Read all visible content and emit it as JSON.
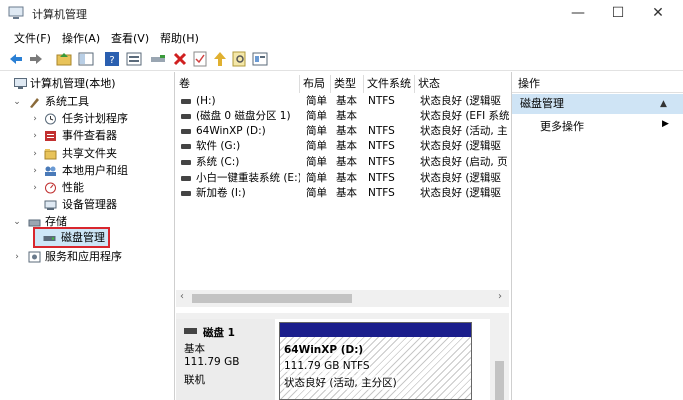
{
  "window": {
    "title": "计算机管理",
    "buttons": {
      "minimize": "—",
      "maximize": "☐",
      "close": "✕"
    }
  },
  "menu": [
    "文件(F)",
    "操作(A)",
    "查看(V)",
    "帮助(H)"
  ],
  "tree": {
    "root": "计算机管理(本地)",
    "items": [
      {
        "label": "系统工具",
        "icon": "tools-icon"
      },
      {
        "label": "任务计划程序",
        "icon": "clock-icon"
      },
      {
        "label": "事件查看器",
        "icon": "event-icon"
      },
      {
        "label": "共享文件夹",
        "icon": "folder-icon"
      },
      {
        "label": "本地用户和组",
        "icon": "users-icon"
      },
      {
        "label": "性能",
        "icon": "performance-icon"
      },
      {
        "label": "设备管理器",
        "icon": "device-icon"
      },
      {
        "label": "存储",
        "icon": "storage-icon"
      },
      {
        "label": "磁盘管理",
        "icon": "disk-icon"
      },
      {
        "label": "服务和应用程序",
        "icon": "services-icon"
      }
    ]
  },
  "list": {
    "headers": [
      "卷",
      "布局",
      "类型",
      "文件系统",
      "状态"
    ],
    "rows": [
      [
        "(H:)",
        "简单",
        "基本",
        "NTFS",
        "状态良好 (逻辑驱"
      ],
      [
        "(磁盘 0 磁盘分区 1)",
        "简单",
        "基本",
        "",
        "状态良好 (EFI 系统"
      ],
      [
        "64WinXP  (D:)",
        "简单",
        "基本",
        "NTFS",
        "状态良好 (活动, 主"
      ],
      [
        "软件 (G:)",
        "简单",
        "基本",
        "NTFS",
        "状态良好 (逻辑驱"
      ],
      [
        "系统 (C:)",
        "简单",
        "基本",
        "NTFS",
        "状态良好 (启动, 页"
      ],
      [
        "小白一键重装系统 (E:)",
        "简单",
        "基本",
        "NTFS",
        "状态良好 (逻辑驱"
      ],
      [
        "新加卷 (I:)",
        "简单",
        "基本",
        "NTFS",
        "状态良好 (逻辑驱"
      ]
    ]
  },
  "disk": {
    "name": "磁盘 1",
    "type": "基本",
    "size": "111.79 GB",
    "status": "联机",
    "partition": {
      "name": "64WinXP   (D:)",
      "size": "111.79 GB NTFS",
      "status": "状态良好 (活动, 主分区)"
    }
  },
  "actions": {
    "header": "操作",
    "section": "磁盘管理",
    "more": "更多操作"
  },
  "colors": {
    "partition_bar": "#1b1e8c",
    "selection": "#cde6f7",
    "highlight_border": "#d9272e"
  }
}
